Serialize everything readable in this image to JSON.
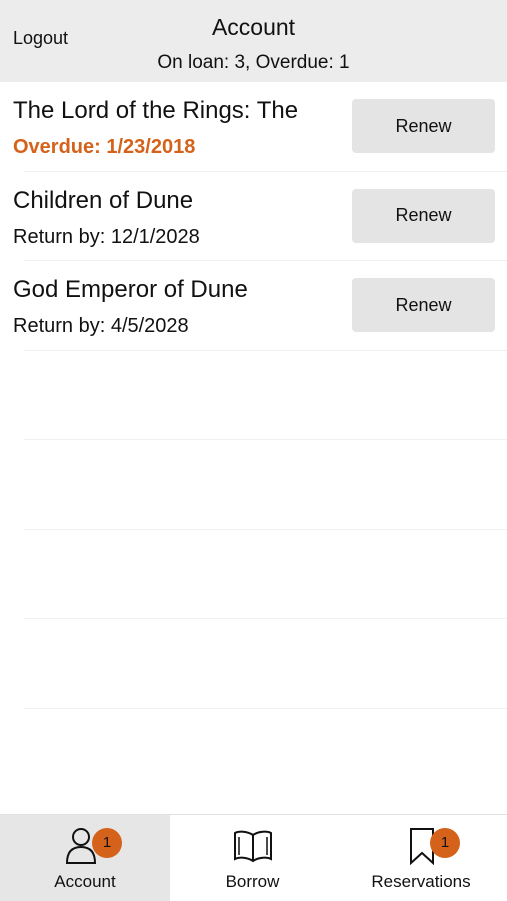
{
  "header": {
    "logout_label": "Logout",
    "title": "Account",
    "summary": "On loan: 3, Overdue: 1"
  },
  "loans": [
    {
      "title": "The Lord of the Rings: The",
      "due_text": "Overdue: 1/23/2018",
      "overdue": true,
      "action_label": "Renew"
    },
    {
      "title": "Children of Dune",
      "due_text": "Return by: 12/1/2028",
      "overdue": false,
      "action_label": "Renew"
    },
    {
      "title": "God Emperor of Dune",
      "due_text": "Return by: 4/5/2028",
      "overdue": false,
      "action_label": "Renew"
    }
  ],
  "tabbar": {
    "tabs": [
      {
        "label": "Account",
        "icon": "person-icon",
        "badge": "1",
        "active": true
      },
      {
        "label": "Borrow",
        "icon": "book-icon",
        "badge": null,
        "active": false
      },
      {
        "label": "Reservations",
        "icon": "bookmark-icon",
        "badge": "1",
        "active": false
      }
    ]
  },
  "colors": {
    "accent": "#d4621a",
    "header_bg": "#ececec",
    "button_bg": "#e4e4e4"
  }
}
